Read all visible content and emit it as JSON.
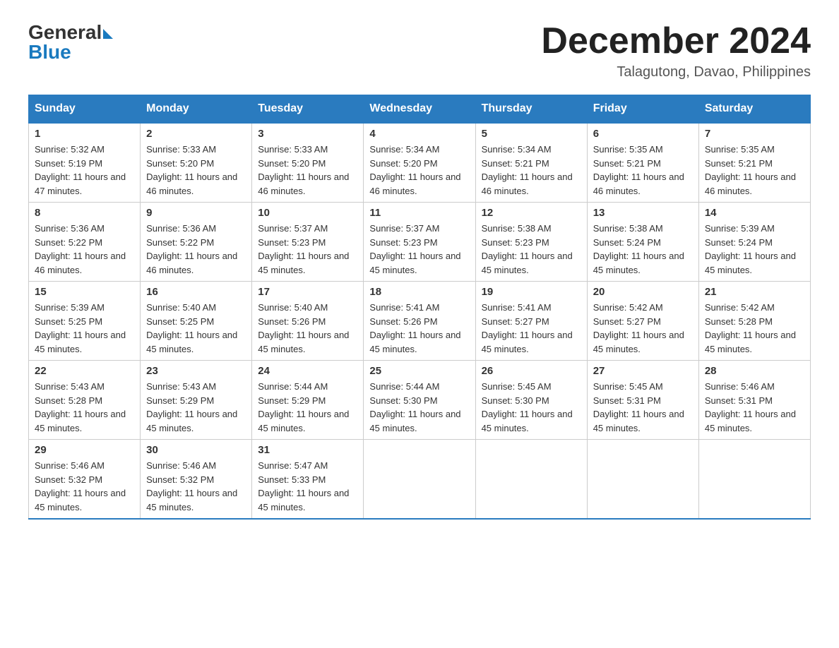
{
  "header": {
    "logo_general": "General",
    "logo_blue": "Blue",
    "month_title": "December 2024",
    "subtitle": "Talagutong, Davao, Philippines"
  },
  "days_of_week": [
    "Sunday",
    "Monday",
    "Tuesday",
    "Wednesday",
    "Thursday",
    "Friday",
    "Saturday"
  ],
  "weeks": [
    [
      {
        "day": "1",
        "sunrise": "5:32 AM",
        "sunset": "5:19 PM",
        "daylight": "11 hours and 47 minutes."
      },
      {
        "day": "2",
        "sunrise": "5:33 AM",
        "sunset": "5:20 PM",
        "daylight": "11 hours and 46 minutes."
      },
      {
        "day": "3",
        "sunrise": "5:33 AM",
        "sunset": "5:20 PM",
        "daylight": "11 hours and 46 minutes."
      },
      {
        "day": "4",
        "sunrise": "5:34 AM",
        "sunset": "5:20 PM",
        "daylight": "11 hours and 46 minutes."
      },
      {
        "day": "5",
        "sunrise": "5:34 AM",
        "sunset": "5:21 PM",
        "daylight": "11 hours and 46 minutes."
      },
      {
        "day": "6",
        "sunrise": "5:35 AM",
        "sunset": "5:21 PM",
        "daylight": "11 hours and 46 minutes."
      },
      {
        "day": "7",
        "sunrise": "5:35 AM",
        "sunset": "5:21 PM",
        "daylight": "11 hours and 46 minutes."
      }
    ],
    [
      {
        "day": "8",
        "sunrise": "5:36 AM",
        "sunset": "5:22 PM",
        "daylight": "11 hours and 46 minutes."
      },
      {
        "day": "9",
        "sunrise": "5:36 AM",
        "sunset": "5:22 PM",
        "daylight": "11 hours and 46 minutes."
      },
      {
        "day": "10",
        "sunrise": "5:37 AM",
        "sunset": "5:23 PM",
        "daylight": "11 hours and 45 minutes."
      },
      {
        "day": "11",
        "sunrise": "5:37 AM",
        "sunset": "5:23 PM",
        "daylight": "11 hours and 45 minutes."
      },
      {
        "day": "12",
        "sunrise": "5:38 AM",
        "sunset": "5:23 PM",
        "daylight": "11 hours and 45 minutes."
      },
      {
        "day": "13",
        "sunrise": "5:38 AM",
        "sunset": "5:24 PM",
        "daylight": "11 hours and 45 minutes."
      },
      {
        "day": "14",
        "sunrise": "5:39 AM",
        "sunset": "5:24 PM",
        "daylight": "11 hours and 45 minutes."
      }
    ],
    [
      {
        "day": "15",
        "sunrise": "5:39 AM",
        "sunset": "5:25 PM",
        "daylight": "11 hours and 45 minutes."
      },
      {
        "day": "16",
        "sunrise": "5:40 AM",
        "sunset": "5:25 PM",
        "daylight": "11 hours and 45 minutes."
      },
      {
        "day": "17",
        "sunrise": "5:40 AM",
        "sunset": "5:26 PM",
        "daylight": "11 hours and 45 minutes."
      },
      {
        "day": "18",
        "sunrise": "5:41 AM",
        "sunset": "5:26 PM",
        "daylight": "11 hours and 45 minutes."
      },
      {
        "day": "19",
        "sunrise": "5:41 AM",
        "sunset": "5:27 PM",
        "daylight": "11 hours and 45 minutes."
      },
      {
        "day": "20",
        "sunrise": "5:42 AM",
        "sunset": "5:27 PM",
        "daylight": "11 hours and 45 minutes."
      },
      {
        "day": "21",
        "sunrise": "5:42 AM",
        "sunset": "5:28 PM",
        "daylight": "11 hours and 45 minutes."
      }
    ],
    [
      {
        "day": "22",
        "sunrise": "5:43 AM",
        "sunset": "5:28 PM",
        "daylight": "11 hours and 45 minutes."
      },
      {
        "day": "23",
        "sunrise": "5:43 AM",
        "sunset": "5:29 PM",
        "daylight": "11 hours and 45 minutes."
      },
      {
        "day": "24",
        "sunrise": "5:44 AM",
        "sunset": "5:29 PM",
        "daylight": "11 hours and 45 minutes."
      },
      {
        "day": "25",
        "sunrise": "5:44 AM",
        "sunset": "5:30 PM",
        "daylight": "11 hours and 45 minutes."
      },
      {
        "day": "26",
        "sunrise": "5:45 AM",
        "sunset": "5:30 PM",
        "daylight": "11 hours and 45 minutes."
      },
      {
        "day": "27",
        "sunrise": "5:45 AM",
        "sunset": "5:31 PM",
        "daylight": "11 hours and 45 minutes."
      },
      {
        "day": "28",
        "sunrise": "5:46 AM",
        "sunset": "5:31 PM",
        "daylight": "11 hours and 45 minutes."
      }
    ],
    [
      {
        "day": "29",
        "sunrise": "5:46 AM",
        "sunset": "5:32 PM",
        "daylight": "11 hours and 45 minutes."
      },
      {
        "day": "30",
        "sunrise": "5:46 AM",
        "sunset": "5:32 PM",
        "daylight": "11 hours and 45 minutes."
      },
      {
        "day": "31",
        "sunrise": "5:47 AM",
        "sunset": "5:33 PM",
        "daylight": "11 hours and 45 minutes."
      },
      null,
      null,
      null,
      null
    ]
  ]
}
